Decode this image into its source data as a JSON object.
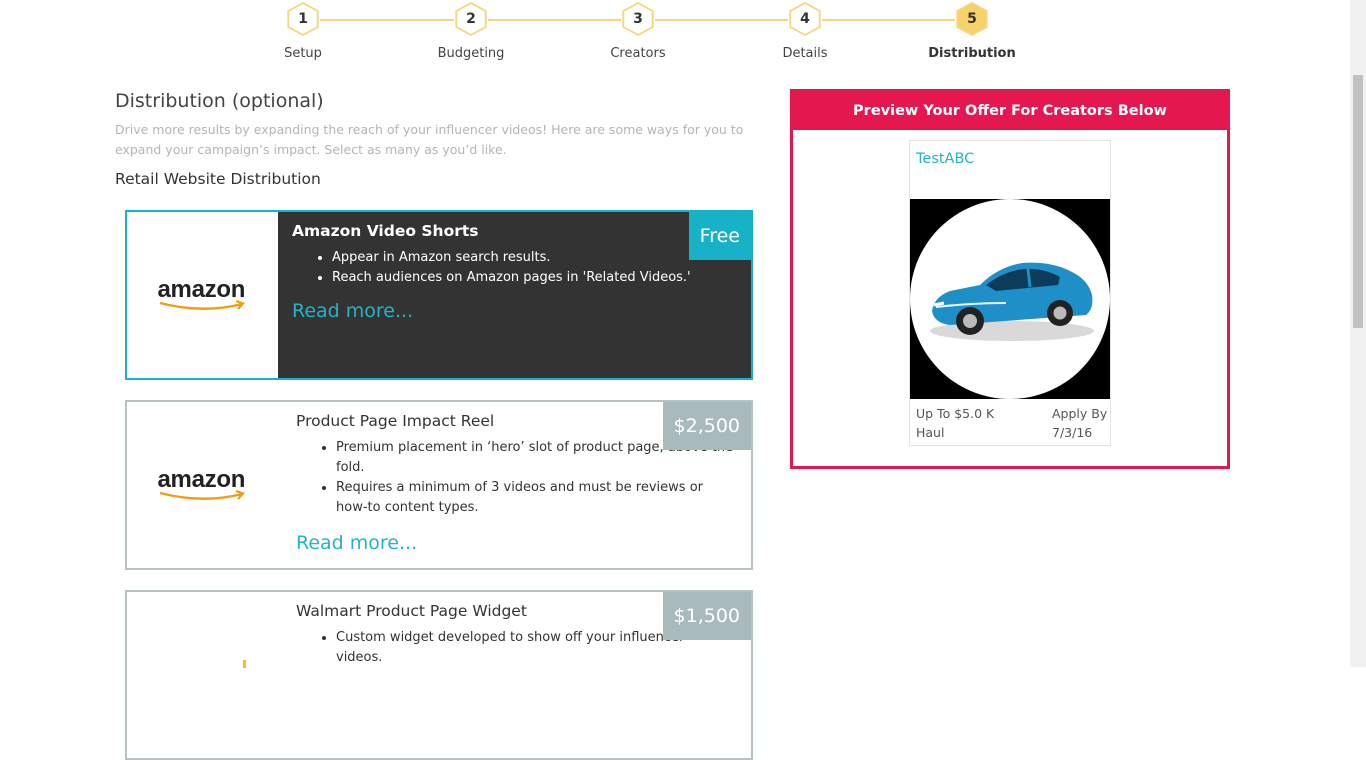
{
  "steps": [
    {
      "num": "1",
      "label": "Setup"
    },
    {
      "num": "2",
      "label": "Budgeting"
    },
    {
      "num": "3",
      "label": "Creators"
    },
    {
      "num": "4",
      "label": "Details"
    },
    {
      "num": "5",
      "label": "Distribution",
      "active": true
    }
  ],
  "section": {
    "title": "Distribution (optional)",
    "description": "Drive more results by expanding the reach of your influencer videos! Here are some ways for you to expand your campaign’s impact. Select as many as you’d like.",
    "subtitle": "Retail Website Distribution"
  },
  "cards": [
    {
      "logo": "amazon",
      "title": "Amazon Video Shorts",
      "price": "Free",
      "selected": true,
      "bullets": [
        "Appear in Amazon search results.",
        "Reach audiences on Amazon pages in 'Related Videos.'"
      ],
      "read_more": "Read more..."
    },
    {
      "logo": "amazon",
      "title": "Product Page Impact Reel",
      "price": "$2,500",
      "selected": false,
      "bullets": [
        "Premium placement in ‘hero’ slot of product page, above the fold.",
        "Requires a minimum of 3 videos and must be reviews or how-to content types."
      ],
      "read_more": "Read more..."
    },
    {
      "logo": "walmart",
      "title": "Walmart Product Page Widget",
      "price": "$1,500",
      "selected": false,
      "bullets": [
        "Custom widget developed to show off your influencer videos."
      ],
      "read_more": ""
    }
  ],
  "preview": {
    "header": "Preview Your Offer For Creators Below",
    "offer_name": "TestABC",
    "budget": "Up To $5.0 K",
    "type": "Haul",
    "apply_label": "Apply By",
    "apply_date": "7/3/16"
  },
  "logos": {
    "amazon": "amazon"
  },
  "colors": {
    "accent": "#18b2c8",
    "preview": "#e4174f",
    "step": "#f5d67c"
  }
}
